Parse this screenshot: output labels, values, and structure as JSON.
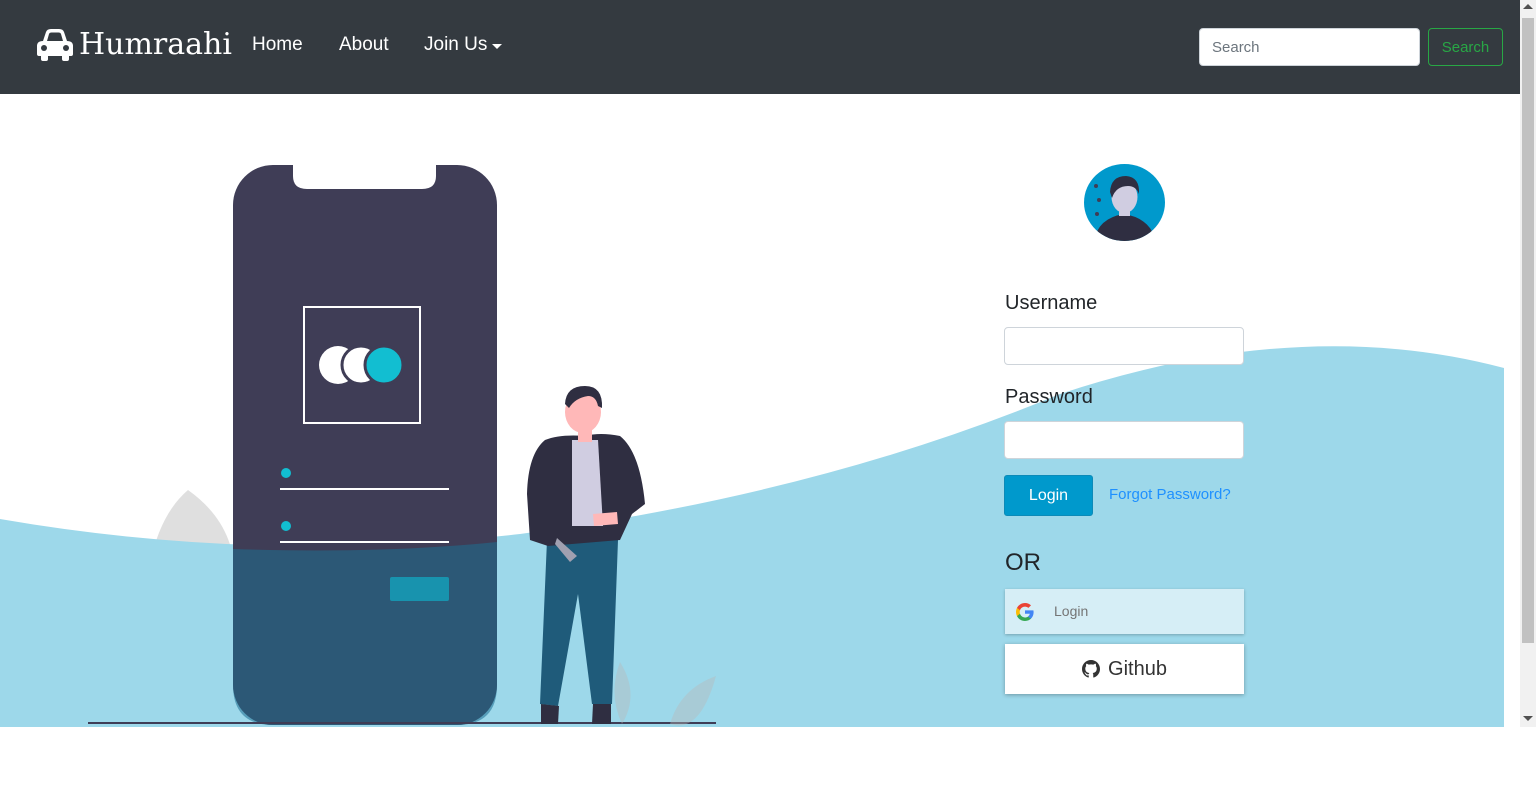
{
  "navbar": {
    "brand": "Humraahi",
    "links": [
      {
        "label": "Home"
      },
      {
        "label": "About"
      },
      {
        "label": "Join Us"
      }
    ],
    "search_placeholder": "Search",
    "search_button": "Search"
  },
  "login_form": {
    "username_label": "Username",
    "password_label": "Password",
    "login_button": "Login",
    "forgot_password": "Forgot Password?",
    "or_text": "OR",
    "google_button": "Login",
    "github_button": "Github"
  },
  "colors": {
    "navbar_bg": "#343a40",
    "accent": "#0099cc",
    "wave": "#9dd8ea",
    "search_btn": "#28a745"
  }
}
